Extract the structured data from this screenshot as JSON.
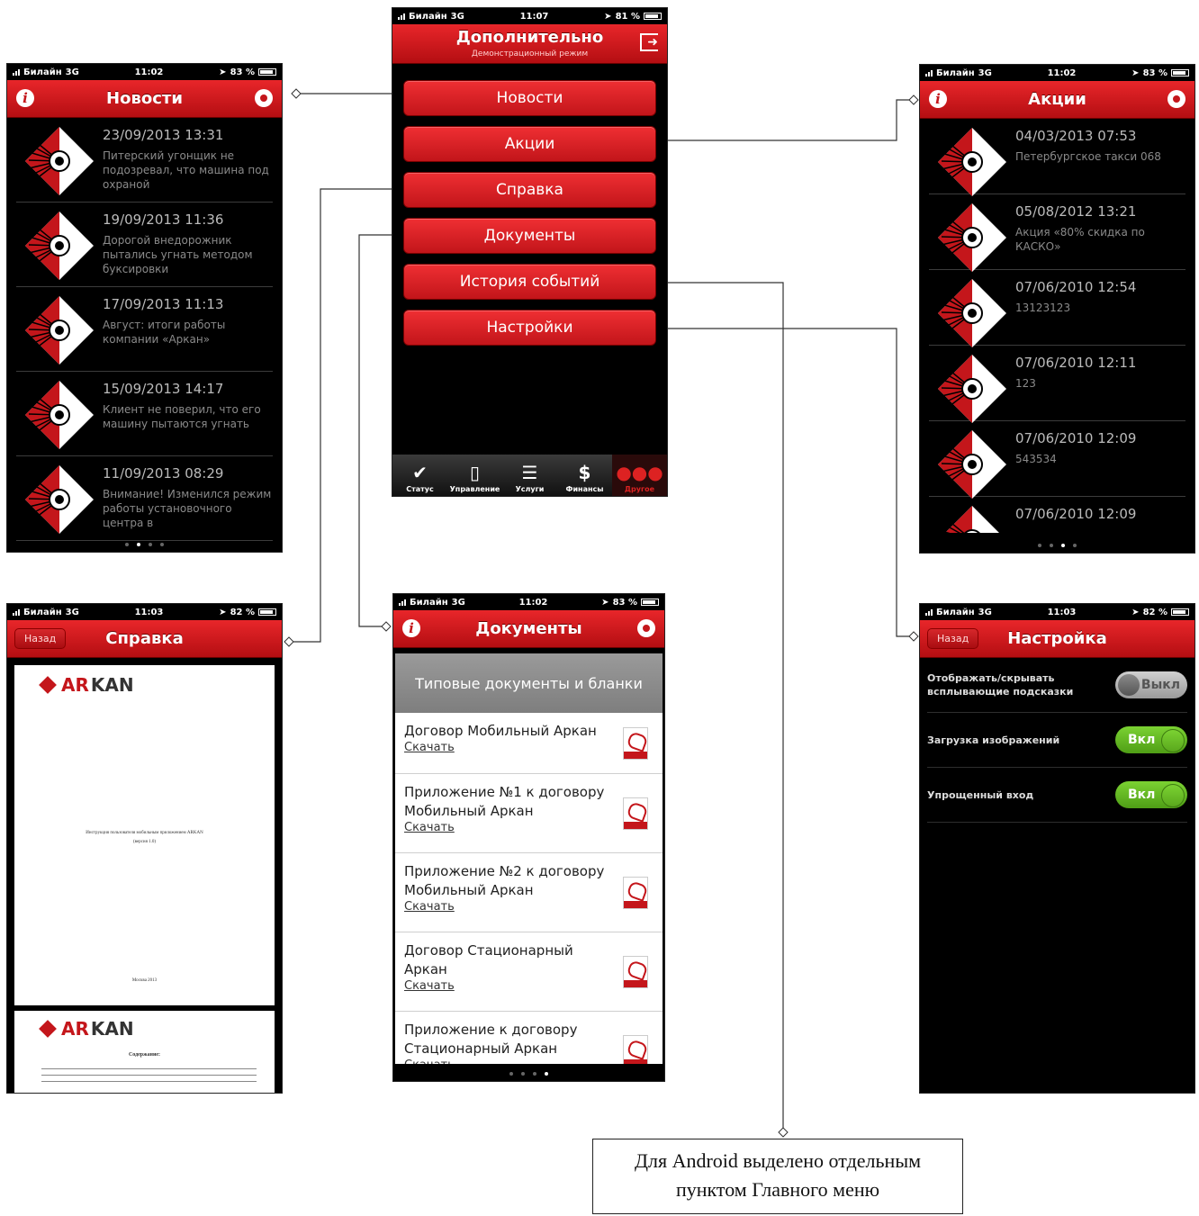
{
  "status": {
    "carrier": "Билайн",
    "network": "3G",
    "t_news": "11:02",
    "b_news": "83 %",
    "t_main": "11:07",
    "b_main": "81 %",
    "t_promo": "11:02",
    "b_promo": "83 %",
    "t_help": "11:03",
    "b_help": "82 %",
    "t_docs": "11:02",
    "b_docs": "83 %",
    "t_set": "11:03",
    "b_set": "82 %"
  },
  "main_menu": {
    "title": "Дополнительно",
    "subtitle": "Демонстрационный режим",
    "buttons": [
      "Новости",
      "Акции",
      "Справка",
      "Документы",
      "История событий",
      "Настройки"
    ],
    "tabs": [
      "Статус",
      "Управление",
      "Услуги",
      "Финансы",
      "Другое"
    ]
  },
  "news": {
    "title": "Новости",
    "items": [
      {
        "date": "23/09/2013 13:31",
        "text": "Питерский угонщик не подозревал, что машина под охраной"
      },
      {
        "date": "19/09/2013 11:36",
        "text": "Дорогой внедорожник пытались угнать методом буксировки"
      },
      {
        "date": "17/09/2013 11:13",
        "text": "Август: итоги работы компании «Аркан»"
      },
      {
        "date": "15/09/2013 14:17",
        "text": "Клиент не поверил, что его машину пытаются угнать"
      },
      {
        "date": "11/09/2013 08:29",
        "text": "Внимание! Изменился режим работы установочного центра в"
      }
    ]
  },
  "promo": {
    "title": "Акции",
    "items": [
      {
        "date": "04/03/2013 07:53",
        "text": "Петербургское такси 068"
      },
      {
        "date": "05/08/2012 13:21",
        "text": "Акция «80% скидка по КАСКО»"
      },
      {
        "date": "07/06/2010 12:54",
        "text": "13123123"
      },
      {
        "date": "07/06/2010 12:11",
        "text": "123"
      },
      {
        "date": "07/06/2010 12:09",
        "text": "543534"
      },
      {
        "date": "07/06/2010 12:09",
        "text": ""
      }
    ]
  },
  "help": {
    "title": "Справка",
    "back": "Назад",
    "logo": "ARKAN",
    "doc_caption_1": "Инструкция пользователя мобильным приложением ARKAN",
    "doc_caption_2": "(версия 1.0)",
    "doc_footer": "Москва 2013",
    "toc_title": "Содержание:"
  },
  "docs": {
    "title": "Документы",
    "header": "Типовые документы и бланки",
    "download": "Скачать",
    "items": [
      "Договор Мобильный Аркан",
      "Приложение №1 к договору Мобильный Аркан",
      "Приложение №2 к договору Мобильный Аркан",
      "Договор Стационарный Аркан",
      "Приложение к договору Стационарный Аркан"
    ]
  },
  "settings": {
    "title": "Настройка",
    "back": "Назад",
    "rows": [
      {
        "label": "Отображать/скрывать всплывающие подсказки",
        "state": "Выкл"
      },
      {
        "label": "Загрузка изображений",
        "state": "Вкл"
      },
      {
        "label": "Упрощенный вход",
        "state": "Вкл"
      }
    ]
  },
  "note": {
    "line1": "Для Android выделено отдельным",
    "line2": "пунктом Главного меню"
  },
  "colors": {
    "brand_red": "#c4161b",
    "toggle_on": "#6cc426",
    "background": "#000000"
  }
}
